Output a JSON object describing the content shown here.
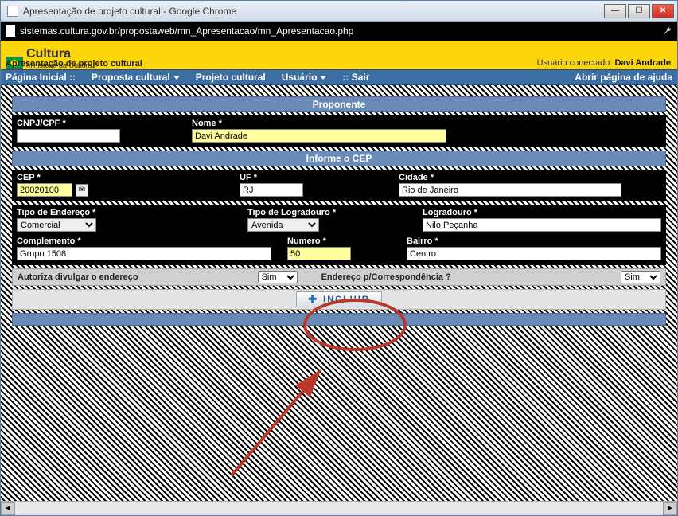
{
  "window": {
    "title": "Apresentação de projeto cultural - Google Chrome",
    "url": "sistemas.cultura.gov.br/propostaweb/mn_Apresentacao/mn_Apresentacao.php"
  },
  "banner": {
    "app": "Cultura",
    "ministry": "Ministério da Cultura",
    "subtitle": "Apresentação de projeto cultural",
    "connected_label": "Usuário conectado:",
    "connected_user": "Davi Andrade"
  },
  "menu": {
    "home": "Página Inicial ::",
    "proposta": "Proposta cultural",
    "projeto": "Projeto cultural",
    "usuario": "Usuário",
    "sair": ":: Sair",
    "help": "Abrir página de ajuda"
  },
  "sections": {
    "proponente": "Proponente",
    "informe_cep": "Informe o CEP"
  },
  "labels": {
    "cnpj": "CNPJ/CPF *",
    "nome": "Nome *",
    "cep": "CEP *",
    "uf": "UF *",
    "cidade": "Cidade *",
    "tipo_endereco": "Tipo de Endereço *",
    "tipo_logradouro": "Tipo de Logradouro *",
    "logradouro": "Logradouro *",
    "complemento": "Complemento *",
    "numero": "Numero *",
    "bairro": "Bairro *",
    "autoriza": "Autoriza divulgar o endereço",
    "correspondencia": "Endereço p/Correspondência ?"
  },
  "values": {
    "cnpj": "",
    "nome": "Davi Andrade",
    "cep": "20020100",
    "uf": "RJ",
    "cidade": "Rio de Janeiro",
    "tipo_endereco": "Comercial",
    "tipo_logradouro": "Avenida",
    "logradouro": "Nilo Peçanha",
    "complemento": "Grupo 1508",
    "numero": "50",
    "bairro": "Centro",
    "autoriza": "Sim",
    "correspondencia": "Sim"
  },
  "buttons": {
    "incluir": "INCLUIR"
  }
}
